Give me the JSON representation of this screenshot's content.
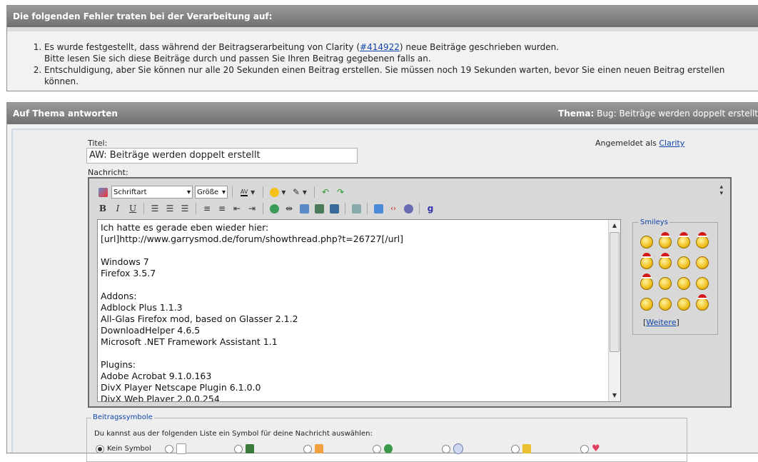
{
  "errors": {
    "header": "Die folgenden Fehler traten bei der Verarbeitung auf:",
    "item1_before": "Es wurde festgestellt, dass während der Beitragserarbeitung von Clarity (",
    "item1_link": "#414922",
    "item1_after": ") neue Beiträge geschrieben wurden.",
    "item1_line2": "Bitte lesen Sie sich diese Beiträge durch und passen Sie Ihren Beitrag gegebenen falls an.",
    "item2": "Entschuldigung, aber Sie können nur alle 20 Sekunden einen Beitrag erstellen. Sie müssen noch 19 Sekunden warten, bevor Sie einen neuen Beitrag erstellen können."
  },
  "reply": {
    "header": "Auf Thema antworten",
    "thema_label": "Thema:",
    "thema_value": " Bug: Beiträge werden doppelt erstellt",
    "title_label": "Titel:",
    "title_value": "AW: Beiträge werden doppelt erstellt",
    "logged_in_label": "Angemeldet als ",
    "logged_in_user": "Clarity",
    "message_label": "Nachricht:"
  },
  "toolbar": {
    "font_select": "Schriftart",
    "size_select": "Größe",
    "bold": "B",
    "italic": "I",
    "underline": "U",
    "color_label": "AV"
  },
  "message_text": "Ich hatte es gerade eben wieder hier:\n[url]http://www.garrysmod.de/forum/showthread.php?t=26727[/url]\n\nWindows 7\nFirefox 3.5.7\n\nAddons:\nAdblock Plus 1.1.3\nAll-Glas Firefox mod, based on Glasser 2.1.2\nDownloadHelper 4.6.5\nMicrosoft .NET Framework Assistant 1.1\n\nPlugins:\nAdobe Acrobat 9.1.0.163\nDivX Player Netscape Plugin 6.1.0.0\nDivX Web Player 2.0.0.254",
  "smileys": {
    "title": "Smileys",
    "more_link": "Weitere",
    "items": [
      "smile",
      "hat",
      "hat",
      "hat",
      "hat",
      "hat",
      "confused",
      "grin",
      "hat",
      "smile",
      "sad",
      "devil",
      "eek",
      "devil",
      "sad",
      "hat"
    ]
  },
  "symbols": {
    "title": "Beitragssymbole",
    "description": "Du kannst aus der folgenden Liste ein Symbol für deine Nachricht auswählen:",
    "none_label": "Kein Symbol"
  },
  "colors": {
    "header_bg": "#808080",
    "link": "#1144aa"
  }
}
